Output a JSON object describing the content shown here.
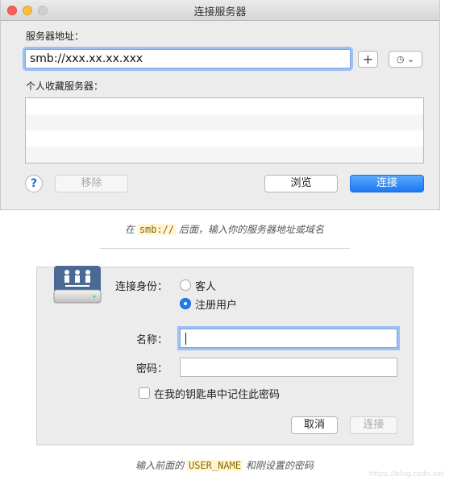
{
  "dialog1": {
    "title": "连接服务器",
    "server_address_label": "服务器地址：",
    "server_address_value": "smb://xxx.xx.xx.xxx",
    "add_label": "+",
    "recent_label": "◷ ⌄",
    "favorites_label": "个人收藏服务器：",
    "help_label": "?",
    "remove_label": "移除",
    "browse_label": "浏览",
    "connect_label": "连接"
  },
  "caption1": {
    "before": "在 ",
    "code": "smb://",
    "after": " 后面，输入你的服务器地址或域名"
  },
  "dialog2": {
    "connect_as_label": "连接身份：",
    "guest_label": "客人",
    "registered_user_label": "注册用户",
    "name_label": "名称：",
    "password_label": "密码：",
    "remember_label": "在我的钥匙串中记住此密码",
    "cancel_label": "取消",
    "connect_label": "连接"
  },
  "caption2": {
    "before": "输入前面的 ",
    "code": "USER_NAME",
    "after": " 和刚设置的密码"
  },
  "colors": {
    "accent": "#1d7bf3",
    "focus_ring": "#9cc0f1",
    "close": "#fc605b",
    "minimize": "#fdbc40"
  },
  "watermark": "https://blog.csdn.net"
}
